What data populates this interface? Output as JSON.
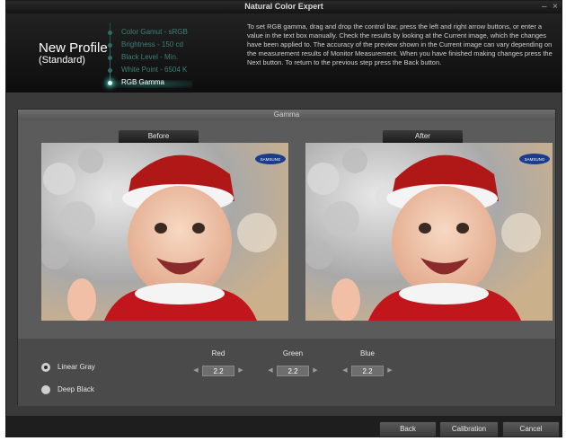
{
  "window": {
    "title": "Natural Color Expert"
  },
  "profile": {
    "name": "New Profile",
    "subtitle": "(Standard)"
  },
  "steps": [
    {
      "label": "Color Gamut - sRGB"
    },
    {
      "label": "Brightness - 150 cd"
    },
    {
      "label": "Black Level - Min."
    },
    {
      "label": "White Point - 6504 K"
    },
    {
      "label": "RGB Gamma",
      "active": true
    }
  ],
  "instructions": "To set RGB gamma, drag and drop the control bar, press the left and right arrow buttons, or enter a value in the text box manually. Check the results by looking at the Current image, which the changes have been applied to. The accuracy of the preview shown in the Current image can vary depending on the measurement results of Monitor Measurement. When you have finished making changes press the Next button. To return to the previous step press the Back button.",
  "panel": {
    "title": "Gamma",
    "before_label": "Before",
    "after_label": "After"
  },
  "preview": {
    "logo_text": "SAMSUNG"
  },
  "options": [
    {
      "label": "Linear Gray",
      "selected": true
    },
    {
      "label": "Deep Black",
      "selected": false
    }
  ],
  "channels": [
    {
      "name": "Red",
      "value": "2.2"
    },
    {
      "name": "Green",
      "value": "2.2"
    },
    {
      "name": "Blue",
      "value": "2.2"
    }
  ],
  "buttons": {
    "back": "Back",
    "calibration": "Calibration",
    "cancel": "Cancel"
  },
  "colors": {
    "accent": "#4fd3c6",
    "header_bg": "#111111",
    "panel_bg": "#5b5b5b"
  }
}
